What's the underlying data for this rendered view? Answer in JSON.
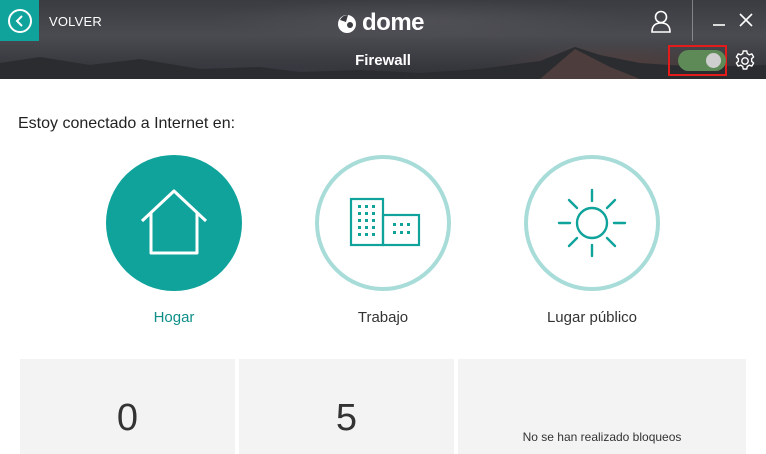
{
  "header": {
    "back_label": "VOLVER",
    "brand": "dome",
    "page_title": "Firewall",
    "firewall_toggle_on": true
  },
  "main": {
    "question": "Estoy conectado a Internet en:",
    "locations": [
      {
        "label": "Hogar",
        "icon": "home-icon",
        "selected": true
      },
      {
        "label": "Trabajo",
        "icon": "buildings-icon",
        "selected": false
      },
      {
        "label": "Lugar público",
        "icon": "sun-icon",
        "selected": false
      }
    ]
  },
  "stats": [
    {
      "value": "0"
    },
    {
      "value": "5"
    },
    {
      "message": "No se han realizado bloqueos"
    }
  ],
  "colors": {
    "accent": "#0fa39b",
    "accent_light": "#a8dcd9",
    "toggle_on": "#5d8a56",
    "highlight": "#e41b1b"
  }
}
